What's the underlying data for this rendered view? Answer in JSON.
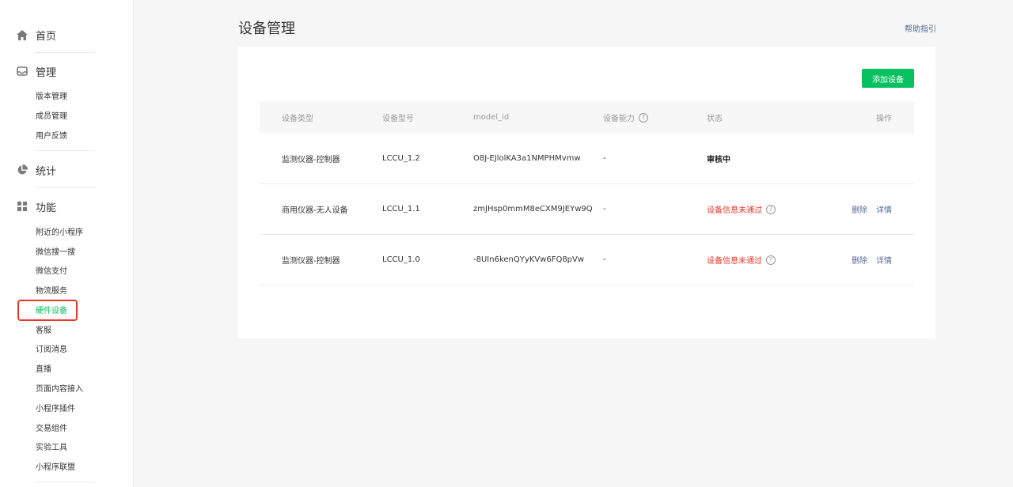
{
  "sidebar": {
    "home": "首页",
    "manage": "管理",
    "manage_items": [
      "版本管理",
      "成员管理",
      "用户反馈"
    ],
    "stats": "统计",
    "features": "功能",
    "feature_items": [
      "附近的小程序",
      "微信搜一搜",
      "微信支付",
      "物流服务",
      "硬件设备",
      "客服",
      "订阅消息",
      "直播",
      "页面内容接入",
      "小程序插件",
      "交易组件",
      "实验工具",
      "小程序联盟"
    ],
    "active_item": "硬件设备"
  },
  "header": {
    "title": "设备管理",
    "help": "帮助指引"
  },
  "toolbar": {
    "add_label": "添加设备"
  },
  "table": {
    "columns": [
      "设备类型",
      "设备型号",
      "model_id",
      "设备能力",
      "状态",
      "操作"
    ],
    "rows": [
      {
        "type": "监测仪器-控制器",
        "model": "LCCU_1.2",
        "model_id": "O8J-EJlolKA3a1NMPHMvmw",
        "capability": "-",
        "status": "审核中",
        "actions": []
      },
      {
        "type": "商用仪器-无人设备",
        "model": "LCCU_1.1",
        "model_id": "zmJHsp0mmM8eCXM9JEYw9Q",
        "capability": "-",
        "status": "设备信息未通过",
        "actions": [
          "删除",
          "详情"
        ]
      },
      {
        "type": "监测仪器-控制器",
        "model": "LCCU_1.0",
        "model_id": "-8UIn6kenQYyKVw6FQ8pVw",
        "capability": "-",
        "status": "设备信息未通过",
        "actions": [
          "删除",
          "详情"
        ]
      }
    ]
  },
  "colors": {
    "accent": "#07c160",
    "link": "#576b95",
    "error": "#e8372a"
  },
  "icons": [
    "home-icon",
    "inbox-icon",
    "pie-chart-icon",
    "grid-icon",
    "question-icon"
  ]
}
